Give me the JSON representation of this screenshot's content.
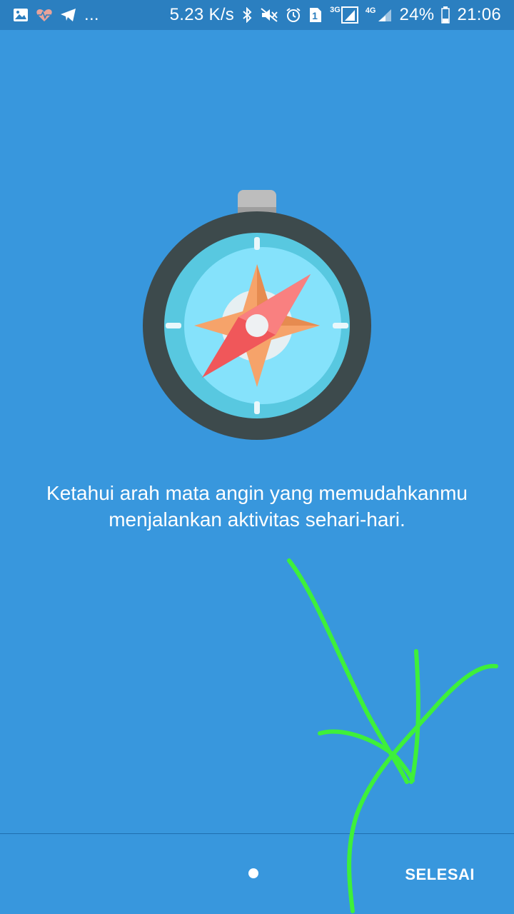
{
  "status_bar": {
    "left_icons": [
      "gallery-icon",
      "heart-rate-icon",
      "telegram-icon"
    ],
    "more": "...",
    "net_speed": "5.23 K/s",
    "sim_badge": "1",
    "network_3g": "3G",
    "network_4g": "4G",
    "battery": "24%",
    "time": "21:06",
    "right_icons": [
      "bluetooth-icon",
      "mute-icon",
      "alarm-icon",
      "sim-icon",
      "signal-3g-icon",
      "signal-4g-icon",
      "battery-icon"
    ]
  },
  "onboarding": {
    "illustration": "compass-icon",
    "description": "Ketahui arah mata angin yang memudahkanmu menjalankan aktivitas sehari-hari."
  },
  "footer": {
    "done_label": "SELESAI",
    "page_count": 1,
    "current_page": 1
  },
  "colors": {
    "background": "#3897dd",
    "status_bar": "#2b7fc0",
    "annotation_stroke": "#3ef03a"
  }
}
